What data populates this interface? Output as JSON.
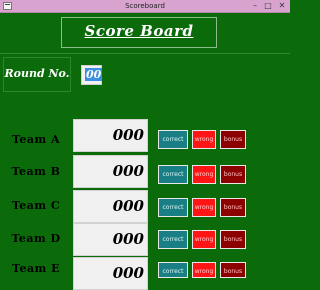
{
  "window": {
    "title": "Scoreboard",
    "controls": {
      "minimize": "–",
      "maximize": "□",
      "close": "✕"
    }
  },
  "header": {
    "title": "Score Board"
  },
  "round": {
    "label": "Round No.",
    "value": "00"
  },
  "teams": [
    {
      "name": "Team A",
      "score": "000"
    },
    {
      "name": "Team B",
      "score": "000"
    },
    {
      "name": "Team C",
      "score": "000"
    },
    {
      "name": "Team D",
      "score": "000"
    },
    {
      "name": "Team E",
      "score": "000"
    }
  ],
  "buttons": {
    "correct": "correct",
    "wrong": "wrong",
    "bonus": "bonus"
  },
  "colors": {
    "background": "#0b6b0b",
    "titlebar": "#d9a3cf",
    "correct": "#1a7f85",
    "wrong": "#ff1515",
    "bonus": "#8c0000",
    "round_highlight": "#3d8fe0"
  }
}
